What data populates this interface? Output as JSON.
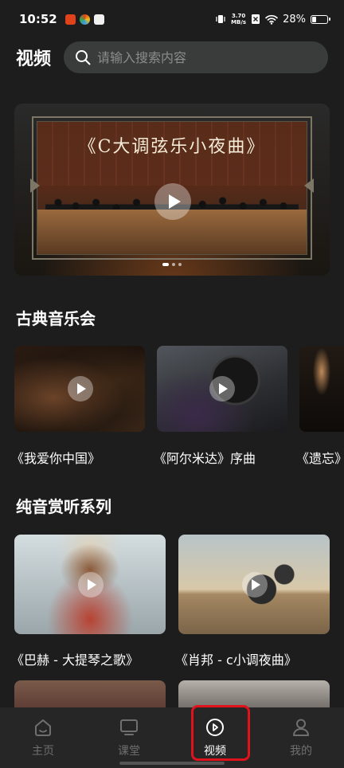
{
  "status_bar": {
    "time": "10:52",
    "net_speed_value": "3.70",
    "net_speed_unit": "MB/s",
    "battery": "28%",
    "battery_level": 0.28,
    "app_icon_colors": [
      "#e0421b",
      "#3b9be0",
      "#f0f0f0"
    ]
  },
  "header": {
    "title": "视频",
    "search_placeholder": "请输入搜索内容"
  },
  "banner": {
    "title": "《C大调弦乐小夜曲》",
    "slide_count": 3,
    "active_slide": 1
  },
  "sections": [
    {
      "title": "古典音乐会",
      "items": [
        {
          "label": "《我爱你中国》"
        },
        {
          "label": "《阿尔米达》序曲"
        },
        {
          "label": "《遗忘》"
        }
      ]
    },
    {
      "title": "纯音赏听系列",
      "items": [
        {
          "label": "《巴赫 - 大提琴之歌》"
        },
        {
          "label": "《肖邦 - c小调夜曲》"
        }
      ]
    }
  ],
  "bottom_nav": {
    "items": [
      {
        "label": "主页",
        "icon": "home-icon"
      },
      {
        "label": "课堂",
        "icon": "tv-icon"
      },
      {
        "label": "视频",
        "icon": "play-circle-icon"
      },
      {
        "label": "我的",
        "icon": "person-icon"
      }
    ],
    "active_index": 2,
    "highlight_color": "#e0121b"
  }
}
